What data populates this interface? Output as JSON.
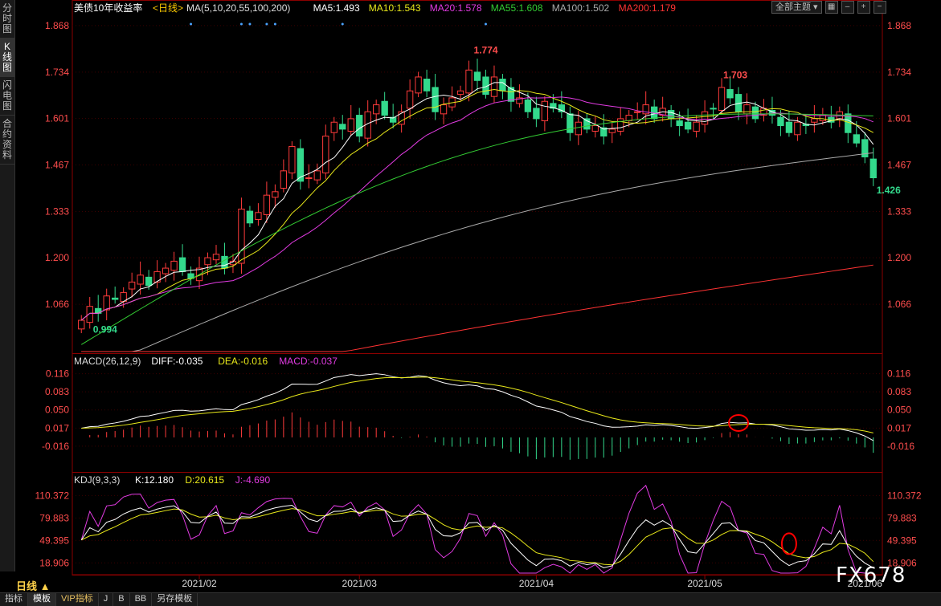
{
  "left_tabs": [
    "分时图",
    "K线图",
    "闪电图",
    "合约资料"
  ],
  "top_buttons": {
    "theme": "全部主题 ▾"
  },
  "period_label": "日线 ▲",
  "watermark": "FX678",
  "bottom_tabs": [
    "指标",
    "模板",
    "VIP指标",
    "J",
    "B",
    "BB",
    "另存模板"
  ],
  "colors": {
    "up": "#ff3b3b",
    "down": "#33d98c",
    "bg": "#000000",
    "grid": "#3a0000",
    "axis": "#8b0000"
  },
  "main": {
    "title": "美债10年收益率",
    "period": "<日线>",
    "legend": [
      {
        "text": "MA(5,10,20,55,100,200)",
        "color": "#dddddd"
      },
      {
        "text": "MA5:1.493",
        "color": "#ffffff"
      },
      {
        "text": "MA10:1.543",
        "color": "#e8e81a"
      },
      {
        "text": "MA20:1.578",
        "color": "#e23be2"
      },
      {
        "text": "MA55:1.608",
        "color": "#33cc33"
      },
      {
        "text": "MA100:1.502",
        "color": "#aaaaaa"
      },
      {
        "text": "MA200:1.179",
        "color": "#ff3333"
      }
    ],
    "y_ticks": [
      "1.868",
      "1.734",
      "1.601",
      "1.467",
      "1.333",
      "1.200",
      "1.066"
    ],
    "ann": [
      {
        "text": "1.774",
        "color": "#ff4d4d"
      },
      {
        "text": "1.703",
        "color": "#ff4d4d"
      },
      {
        "text": "0.994",
        "color": "#33d98c"
      },
      {
        "text": "1.426",
        "color": "#33d98c"
      }
    ]
  },
  "macd": {
    "legend": [
      {
        "text": "MACD(26,12,9)",
        "color": "#dddddd"
      },
      {
        "text": "DIFF:-0.035",
        "color": "#ffffff"
      },
      {
        "text": "DEA:-0.016",
        "color": "#e8e81a"
      },
      {
        "text": "MACD:-0.037",
        "color": "#e23be2"
      }
    ],
    "y_ticks": [
      "0.116",
      "0.083",
      "0.050",
      "0.017",
      "-0.016"
    ]
  },
  "kdj": {
    "legend": [
      {
        "text": "KDJ(9,3,3)",
        "color": "#dddddd"
      },
      {
        "text": "K:12.180",
        "color": "#ffffff"
      },
      {
        "text": "D:20.615",
        "color": "#e8e81a"
      },
      {
        "text": "J:-4.690",
        "color": "#e23be2"
      }
    ],
    "y_ticks": [
      "110.372",
      "79.883",
      "49.395",
      "18.906"
    ]
  },
  "x_labels": [
    "2021/02",
    "2021/03",
    "2021/04",
    "2021/05",
    "2021/06"
  ],
  "chart_data": [
    {
      "type": "candlestick",
      "title": "美债10年收益率",
      "period": "日线",
      "ylim": [
        0.93,
        1.9
      ],
      "y_ticks": [
        1.868,
        1.734,
        1.601,
        1.467,
        1.333,
        1.2,
        1.066
      ],
      "x_ticks": [
        "2021/02",
        "2021/03",
        "2021/04",
        "2021/05",
        "2021/06"
      ],
      "high": 1.774,
      "low": 0.994,
      "last": 1.426,
      "ma_last": {
        "MA5": 1.493,
        "MA10": 1.543,
        "MA20": 1.578,
        "MA55": 1.608,
        "MA100": 1.502,
        "MA200": 1.179
      },
      "close": [
        1.02,
        1.06,
        1.04,
        1.09,
        1.08,
        1.1,
        1.13,
        1.15,
        1.12,
        1.16,
        1.17,
        1.19,
        1.16,
        1.14,
        1.17,
        1.2,
        1.21,
        1.17,
        1.19,
        1.34,
        1.3,
        1.33,
        1.38,
        1.39,
        1.45,
        1.52,
        1.42,
        1.43,
        1.45,
        1.55,
        1.59,
        1.57,
        1.6,
        1.55,
        1.62,
        1.64,
        1.61,
        1.59,
        1.62,
        1.68,
        1.72,
        1.68,
        1.62,
        1.64,
        1.66,
        1.68,
        1.74,
        1.71,
        1.67,
        1.72,
        1.68,
        1.65,
        1.66,
        1.62,
        1.6,
        1.65,
        1.63,
        1.62,
        1.56,
        1.59,
        1.57,
        1.58,
        1.55,
        1.57,
        1.6,
        1.61,
        1.62,
        1.64,
        1.6,
        1.63,
        1.6,
        1.58,
        1.57,
        1.59,
        1.62,
        1.63,
        1.69,
        1.66,
        1.62,
        1.64,
        1.6,
        1.63,
        1.61,
        1.58,
        1.56,
        1.59,
        1.58,
        1.6,
        1.61,
        1.59,
        1.62,
        1.56,
        1.53,
        1.49,
        1.43
      ]
    },
    {
      "type": "macd",
      "params": "26,12,9",
      "DIFF": -0.035,
      "DEA": -0.016,
      "MACD": -0.037,
      "ylim": [
        -0.06,
        0.13
      ],
      "y_ticks": [
        0.116,
        0.083,
        0.05,
        0.017,
        -0.016
      ]
    },
    {
      "type": "kdj",
      "params": "9,3,3",
      "K": 12.18,
      "D": 20.615,
      "J": -4.69,
      "ylim": [
        5,
        125
      ],
      "y_ticks": [
        110.372,
        79.883,
        49.395,
        18.906
      ]
    }
  ]
}
